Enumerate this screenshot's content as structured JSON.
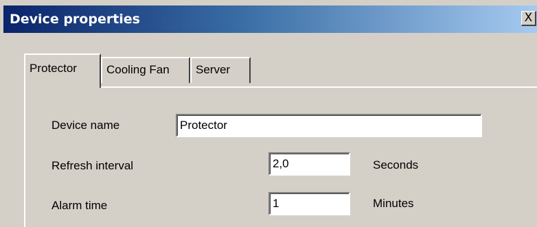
{
  "window": {
    "title": "Device properties",
    "close_label": "X"
  },
  "tabs": [
    {
      "label": "Protector",
      "active": true
    },
    {
      "label": "Cooling Fan",
      "active": false
    },
    {
      "label": "Server",
      "active": false
    }
  ],
  "form": {
    "device_name": {
      "label": "Device name",
      "value": "Protector"
    },
    "refresh_interval": {
      "label": "Refresh interval",
      "value": "2,0",
      "unit": "Seconds"
    },
    "alarm_time": {
      "label": "Alarm time",
      "value": "1",
      "unit": "Minutes"
    }
  }
}
